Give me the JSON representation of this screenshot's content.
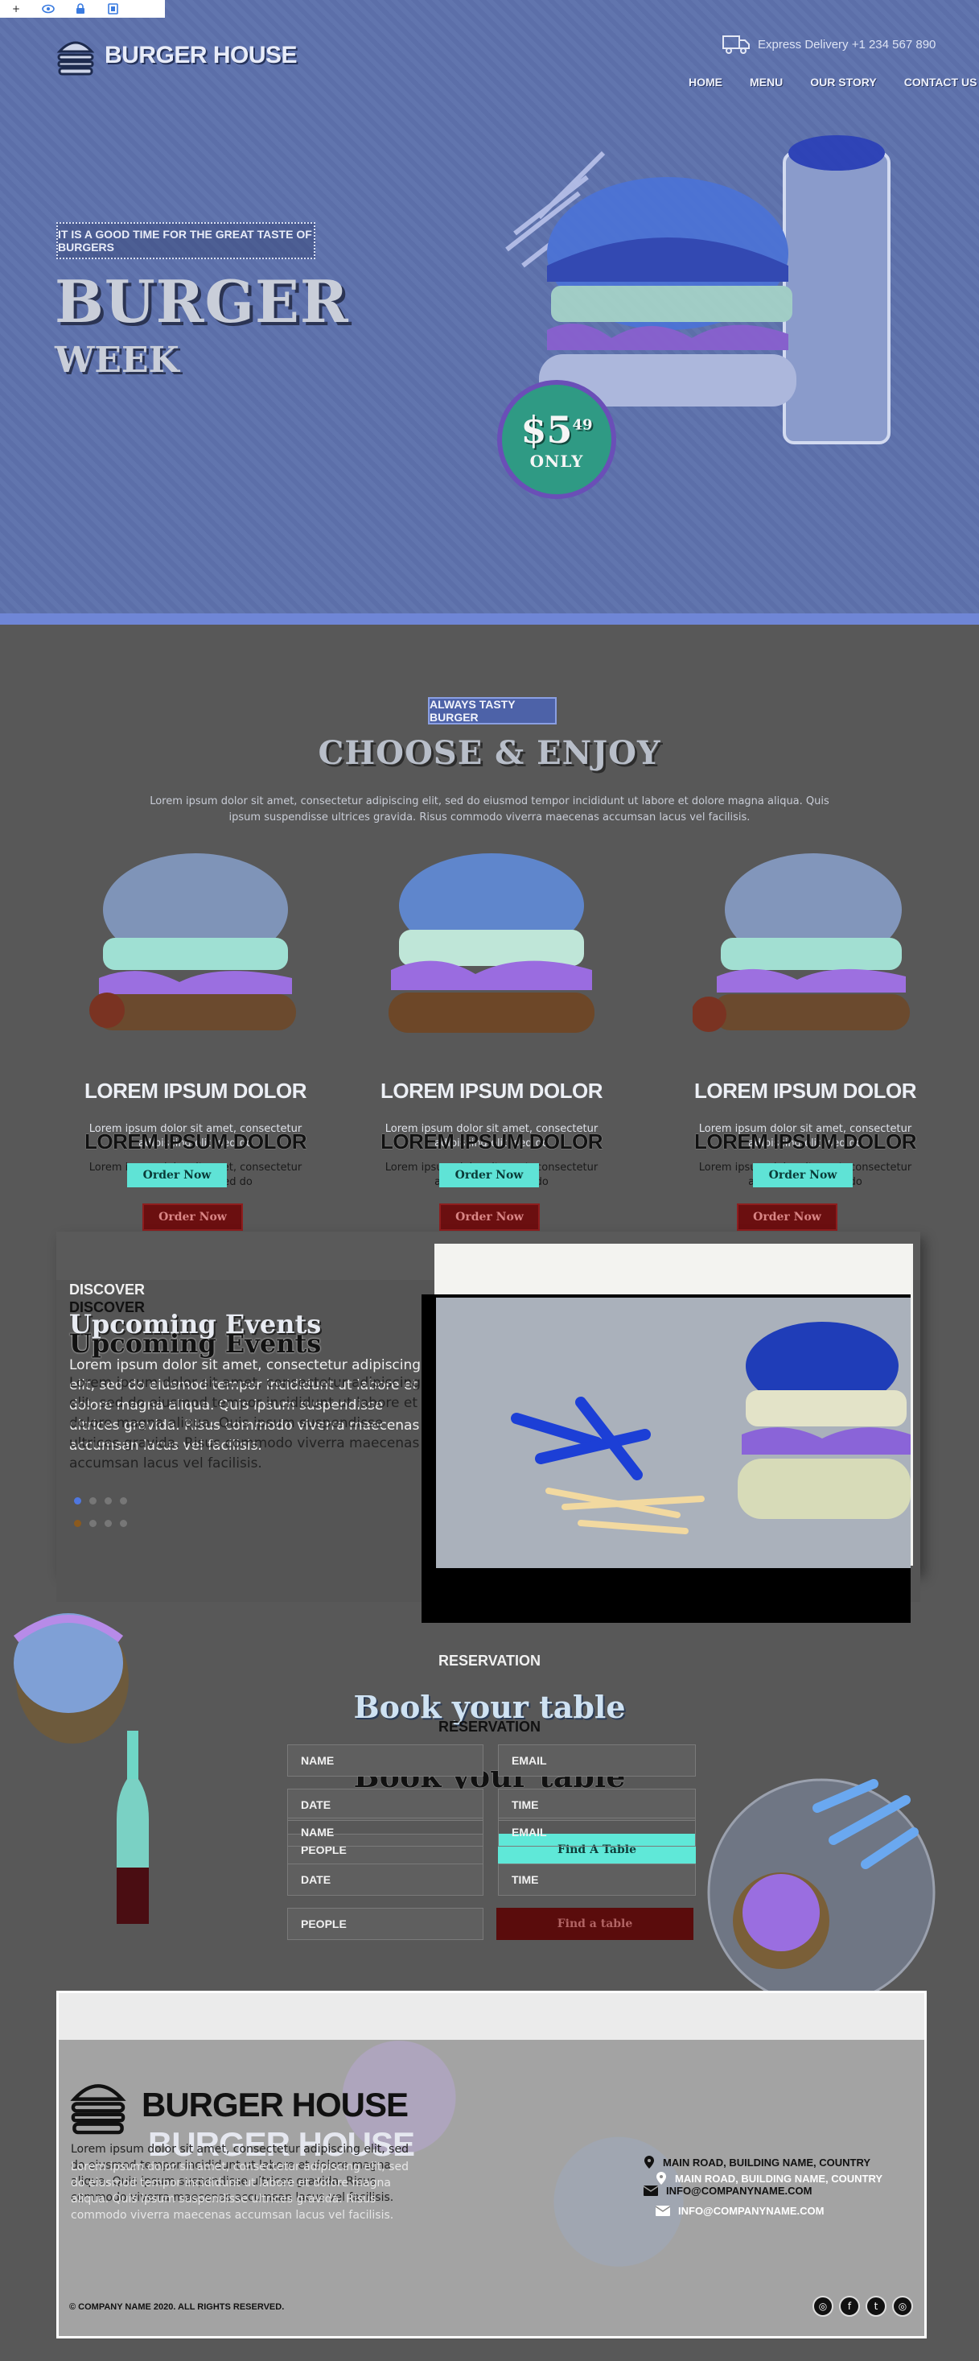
{
  "toolbar": {
    "icons": [
      "plus-icon",
      "eye-icon",
      "lock-icon",
      "copy-icon"
    ],
    "plus_glyph": "+"
  },
  "header": {
    "brand": "BURGER HOUSE",
    "delivery": "Express Delivery +1 234 567 890",
    "nav": [
      "HOME",
      "MENU",
      "OUR STORY",
      "CONTACT US"
    ]
  },
  "hero": {
    "tagline": "IT IS A GOOD TIME FOR THE GREAT TASTE OF BURGERS",
    "title": "BURGER",
    "subtitle": "WEEK",
    "price": "$5",
    "price_cents": "49",
    "price_note": "ONLY"
  },
  "menu_section": {
    "label": "ALWAYS TASTY BURGER",
    "title": "CHOOSE & ENJOY",
    "description": "Lorem ipsum dolor sit amet, consectetur adipiscing elit, sed do eiusmod tempor incididunt ut labore et dolore magna aliqua. Quis ipsum suspendisse ultrices gravida. Risus commodo viverra maecenas accumsan lacus vel facilisis.",
    "products": [
      {
        "name": "LOREM IPSUM DOLOR",
        "desc": "Lorem ipsum dolor sit amet, consectetur adipiscing elit, sed do",
        "button": "Order Now"
      },
      {
        "name": "LOREM IPSUM DOLOR",
        "desc": "Lorem ipsum dolor sit amet, consectetur adipiscing elit, sed do",
        "button": "Order Now"
      },
      {
        "name": "LOREM IPSUM DOLOR",
        "desc": "Lorem ipsum dolor sit amet, consectetur adipiscing elit, sed do",
        "button": "Order Now"
      }
    ]
  },
  "events": {
    "label": "DISCOVER",
    "title": "Upcoming Events",
    "description": "Lorem ipsum dolor sit amet, consectetur adipiscing elit, sed do eiusmod tempor incididunt ut labore et dolore magna aliqua. Quis ipsum suspendisse ultrices gravida. Risus commodo viverra maecenas accumsan lacus vel facilisis."
  },
  "reservation": {
    "label": "RESERVATION",
    "title": "Book your table",
    "name_placeholder": "NAME",
    "email_placeholder": "EMAIL",
    "date_placeholder": "DATE",
    "time_placeholder": "TIME",
    "people_placeholder": "PEOPLE",
    "button_ghost": "Find A Table",
    "button": "Find a table"
  },
  "footer": {
    "brand": "BURGER HOUSE",
    "description": "Lorem ipsum dolor sit amet, consectetur adipiscing elit, sed do eiusmod tempor incididunt ut labore et dolore magna aliqua. Quis ipsum suspendisse ultrices gravida. Risus commodo viverra maecenas accumsan lacus vel facilisis.",
    "address": "MAIN ROAD, BUILDING NAME, COUNTRY",
    "email": "INFO@COMPANYNAME.COM",
    "copyright": "© COMPANY NAME 2020. ALL RIGHTS RESERVED.",
    "socials": [
      "instagram-icon",
      "facebook-icon",
      "twitter-icon",
      "instagram-icon"
    ],
    "social_glyphs": [
      "◎",
      "f",
      "t",
      "◎"
    ]
  }
}
